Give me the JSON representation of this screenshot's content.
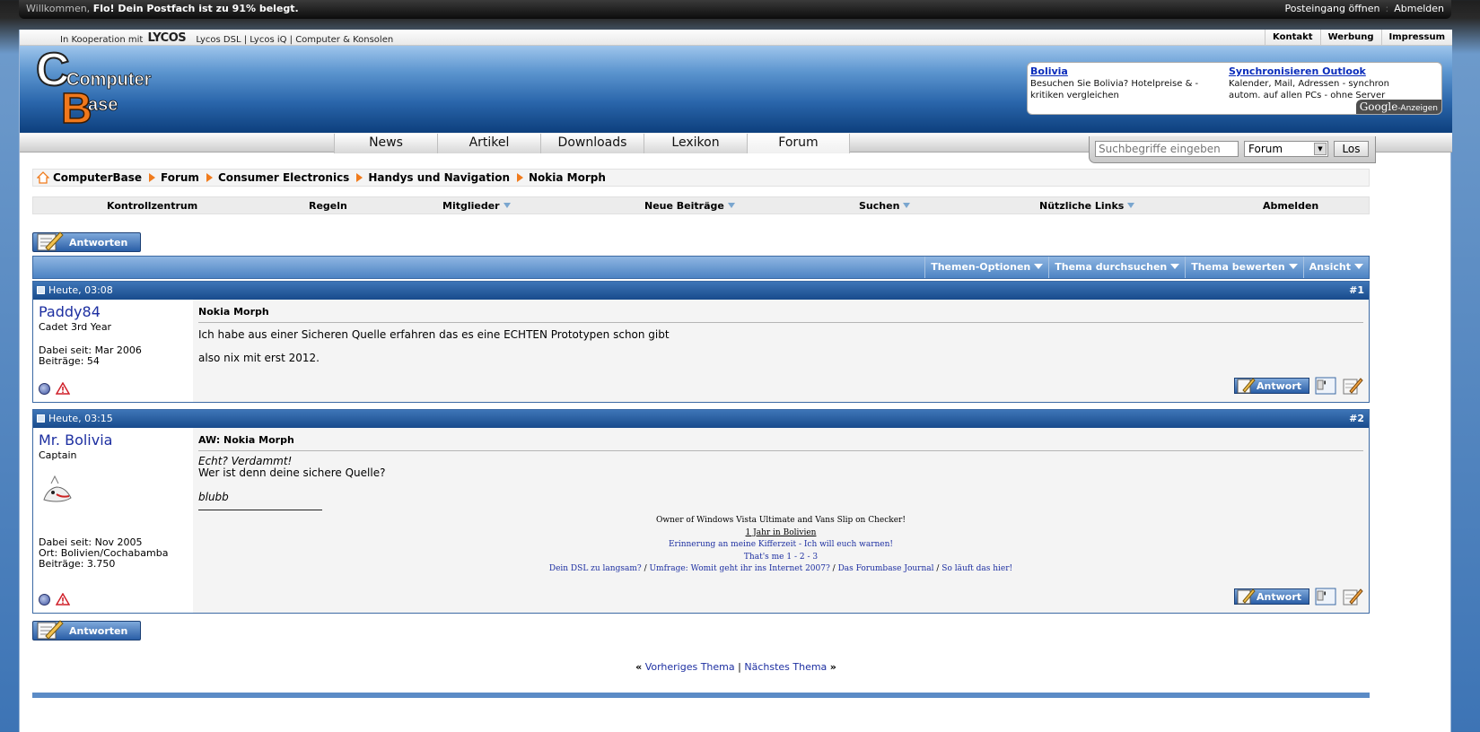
{
  "topbar": {
    "welcome_prefix": "Willkommen, ",
    "user": "Flo",
    "welcome_suffix": "! Dein Postfach ist zu 91% belegt.",
    "inbox": "Posteingang öffnen",
    "logout": "Abmelden"
  },
  "coop": {
    "prefix": "In Kooperation mit",
    "brand": "LYCOS",
    "links": "Lycos DSL | Lycos iQ | Computer & Konsolen",
    "right": [
      "Kontakt",
      "Werbung",
      "Impressum"
    ]
  },
  "logo": {
    "line1": "Computer",
    "line2": "Base"
  },
  "ads": [
    {
      "title": "Bolivia",
      "text": "Besuchen Sie Bolivia? Hotelpreise & -kritiken vergleichen"
    },
    {
      "title": "Synchronisieren Outlook",
      "text": "Kalender, Mail, Adressen - synchron autom. auf allen PCs - ohne Server"
    }
  ],
  "google_label": {
    "brand": "Google",
    "suffix": "-Anzeigen"
  },
  "nav": [
    "News",
    "Artikel",
    "Downloads",
    "Lexikon",
    "Forum"
  ],
  "search": {
    "placeholder": "Suchbegriffe eingeben",
    "scope": "Forum",
    "button": "Los"
  },
  "breadcrumb": [
    "ComputerBase",
    "Forum",
    "Consumer Electronics",
    "Handys und Navigation",
    "Nokia Morph"
  ],
  "navbar": {
    "items": [
      "Kontrollzentrum",
      "Regeln",
      "Mitglieder",
      "Neue Beiträge",
      "Suchen",
      "Nützliche Links",
      "Abmelden"
    ]
  },
  "reply_label": "Antworten",
  "thread_tools": [
    "Themen-Optionen",
    "Thema durchsuchen",
    "Thema bewerten",
    "Ansicht"
  ],
  "posts": [
    {
      "date": "Heute, 03:08",
      "num": "#1",
      "user": "Paddy84",
      "rank": "Cadet 3rd Year",
      "joined": "Dabei seit: Mar 2006",
      "location": "",
      "posts_count": "Beiträge: 54",
      "title": "Nokia Morph",
      "lines": [
        "Ich habe aus einer Sicheren Quelle erfahren das es eine ECHTEN Prototypen schon gibt",
        "also nix mit erst 2012."
      ]
    },
    {
      "date": "Heute, 03:15",
      "num": "#2",
      "user": "Mr. Bolivia",
      "rank": "Captain",
      "joined": "Dabei seit: Nov 2005",
      "location": "Ort: Bolivien/Cochabamba",
      "posts_count": "Beiträge: 3.750",
      "title": "AW: Nokia Morph",
      "lines": [
        "Echt? Verdammt!",
        "Wer ist denn deine sichere Quelle?",
        "blubb"
      ],
      "sig": {
        "l1": "Owner of Windows Vista Ultimate and Vans Slip on Checker!",
        "l2": "1 Jahr in Bolivien",
        "l3": "Erinnerung an meine Kifferzeit - Ich will euch warnen!",
        "l4": "That's me 1 - 2 - 3",
        "l5a": "Dein DSL zu langsam?",
        "l5b": "Umfrage: Womit geht ihr ins Internet 2007?",
        "l5c": "Das Forumbase Journal",
        "l5d": "So läuft das hier!"
      }
    }
  ],
  "post_reply_small": "Antwort",
  "prevnext": {
    "prev": "Vorheriges Thema",
    "next": "Nächstes Thema"
  }
}
